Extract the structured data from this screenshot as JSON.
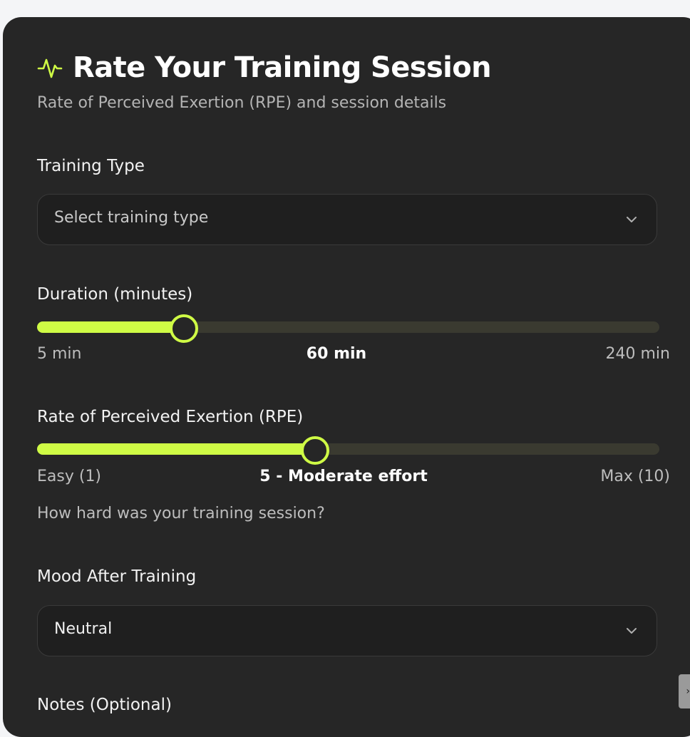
{
  "header": {
    "icon": "activity-pulse-icon",
    "title": "Rate Your Training Session",
    "subtitle": "Rate of Perceived Exertion (RPE) and session details"
  },
  "training_type": {
    "label": "Training Type",
    "placeholder": "Select training type",
    "value": ""
  },
  "duration": {
    "label": "Duration (minutes)",
    "min_label": "5 min",
    "max_label": "240 min",
    "value_label": "60 min",
    "min": 5,
    "max": 240,
    "value": 60
  },
  "rpe": {
    "label": "Rate of Perceived Exertion (RPE)",
    "min_label": "Easy (1)",
    "max_label": "Max (10)",
    "value_label": "5 - Moderate effort",
    "min": 1,
    "max": 10,
    "value": 5,
    "hint": "How hard was your training session?"
  },
  "mood": {
    "label": "Mood After Training",
    "value": "Neutral"
  },
  "notes": {
    "label": "Notes (Optional)"
  },
  "colors": {
    "accent": "#cffb45",
    "card_bg": "#262626",
    "page_bg": "#f4f5f7"
  }
}
